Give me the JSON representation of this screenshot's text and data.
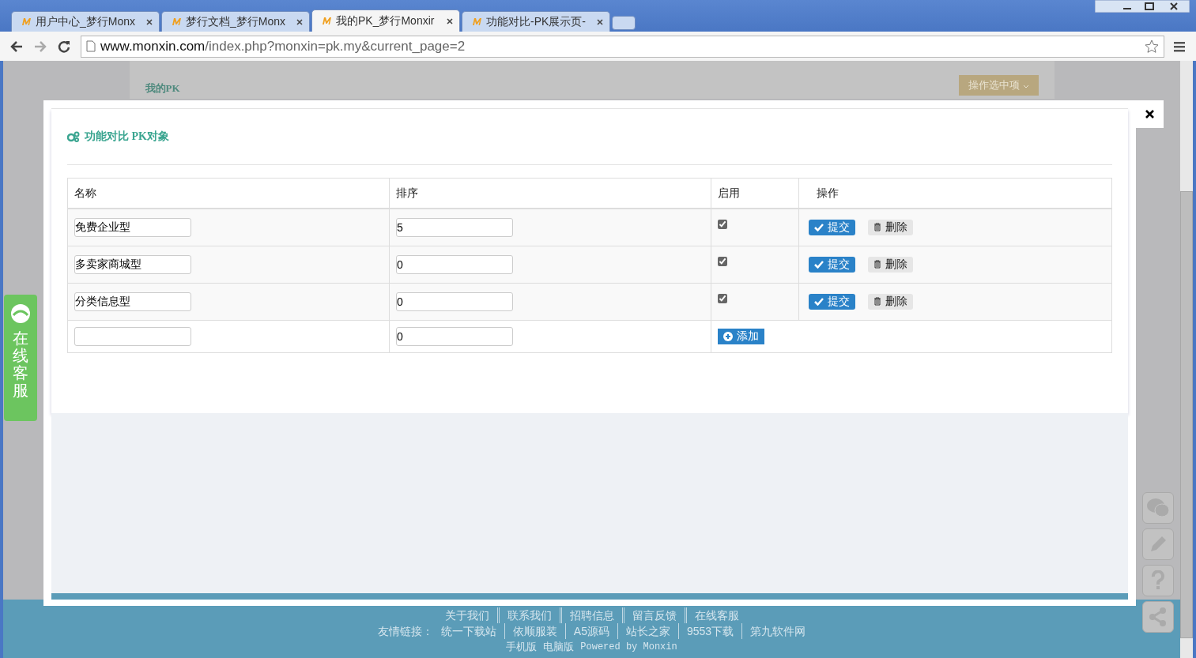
{
  "browser": {
    "tabs": [
      {
        "title": "用户中心_梦行Monx",
        "selected": false
      },
      {
        "title": "梦行文档_梦行Monx",
        "selected": false
      },
      {
        "title": "我的PK_梦行Monxir",
        "selected": true
      },
      {
        "title": "功能对比-PK展示页-",
        "selected": false
      }
    ],
    "url_host": "www.monxin.com",
    "url_path": "/index.php?monxin=pk.my&current_page=2"
  },
  "page": {
    "header_title": "我的PK",
    "action_button": "操作选中项",
    "footer": {
      "nav_links": [
        "关于我们",
        "联系我们",
        "招聘信息",
        "留言反馈",
        "在线客服"
      ],
      "friend_label": "友情链接：",
      "friend_links": [
        "统一下载站",
        "依顺服装",
        "A5源码",
        "站长之家",
        "9553下载",
        "第九软件网"
      ],
      "bottom_links": [
        "手机版",
        "电脑版"
      ],
      "powered": "Powered by Monxin"
    }
  },
  "side_tab": {
    "label": "在线客服"
  },
  "modal": {
    "title": "功能对比 PK对象",
    "columns": [
      "名称",
      "排序",
      "启用",
      "操作"
    ],
    "rows": [
      {
        "name": "免费企业型",
        "order": "5",
        "enabled": true,
        "submit": "提交",
        "delete": "删除"
      },
      {
        "name": "多卖家商城型",
        "order": "0",
        "enabled": true,
        "submit": "提交",
        "delete": "删除"
      },
      {
        "name": "分类信息型",
        "order": "0",
        "enabled": true,
        "submit": "提交",
        "delete": "删除"
      }
    ],
    "new_row": {
      "order": "0",
      "add": "添加"
    }
  }
}
